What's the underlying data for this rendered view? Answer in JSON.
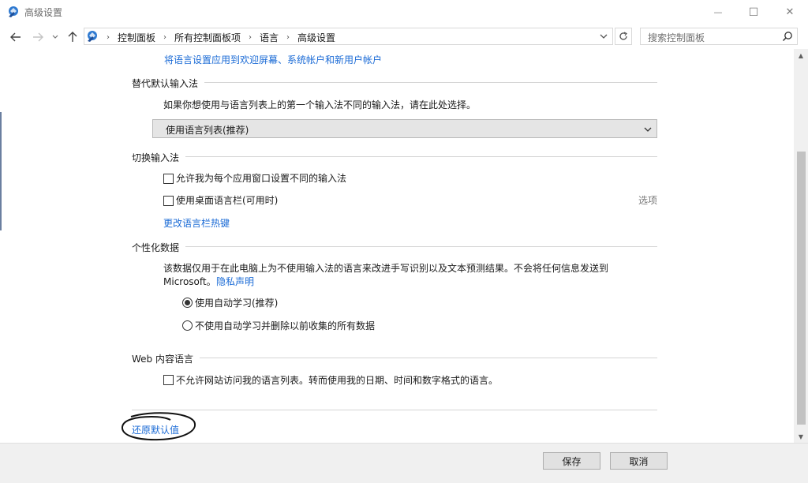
{
  "window": {
    "title": "高级设置",
    "minimize_glyph": "—",
    "maximize_glyph": "☐",
    "close_glyph": "✕"
  },
  "nav": {
    "back_icon": "arrow-left-icon",
    "forward_icon": "arrow-right-icon",
    "recent_icon": "chevron-down-icon",
    "up_icon": "arrow-up-icon",
    "breadcrumbs": [
      "控制面板",
      "所有控制面板项",
      "语言",
      "高级设置"
    ],
    "search_placeholder": "搜索控制面板"
  },
  "content": {
    "apply_link": "将语言设置应用到欢迎屏幕、系统帐户和新用户帐户",
    "override_input": {
      "title": "替代默认输入法",
      "description": "如果你想使用与语言列表上的第一个输入法不同的输入法，请在此处选择。",
      "selected": "使用语言列表(推荐)"
    },
    "switch_input": {
      "title": "切换输入法",
      "per_app_checkbox": "允许我为每个应用窗口设置不同的输入法",
      "per_app_checked": false,
      "desktop_bar_checkbox": "使用桌面语言栏(可用时)",
      "desktop_bar_checked": false,
      "options_link": "选项",
      "hotkeys_link": "更改语言栏热键"
    },
    "personalization": {
      "title": "个性化数据",
      "description_line1": "该数据仅用于在此电脑上为不使用输入法的语言来改进手写识别以及文本预测结果。不会将任何信息发送到",
      "description_line2": "Microsoft。",
      "privacy_link": "隐私声明",
      "radio_auto": "使用自动学习(推荐)",
      "radio_off": "不使用自动学习并删除以前收集的所有数据",
      "selected_option": "radio_auto"
    },
    "web_language": {
      "title": "Web 内容语言",
      "checkbox": "不允许网站访问我的语言列表。转而使用我的日期、时间和数字格式的语言。",
      "checked": false
    },
    "restore_defaults_link": "还原默认值"
  },
  "footer": {
    "save": "保存",
    "cancel": "取消"
  },
  "colors": {
    "link": "#1b6bd6",
    "footer_bg": "#f0f0f0",
    "annotation_ink": "#111111"
  }
}
